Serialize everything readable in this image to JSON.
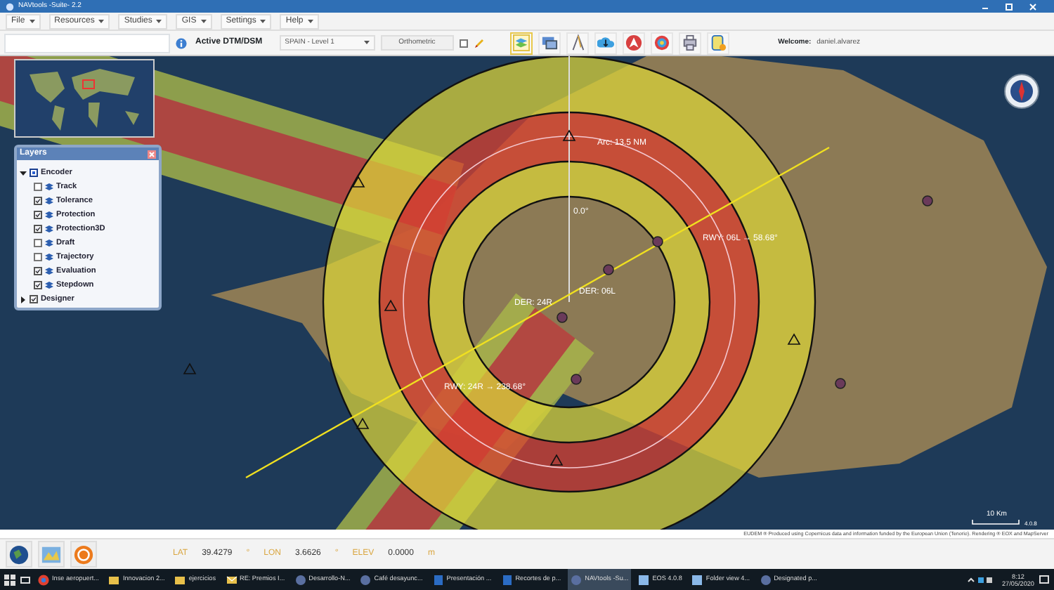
{
  "window": {
    "title": "NAVtools -Suite- 2.2"
  },
  "menu": [
    {
      "label": "File"
    },
    {
      "label": "Resources"
    },
    {
      "label": "Studies"
    },
    {
      "label": "GIS"
    },
    {
      "label": "Settings"
    },
    {
      "label": "Help"
    }
  ],
  "toolbar": {
    "dtm_label": "Active DTM/DSM",
    "dtm_select": "SPAIN - Level 1",
    "height_button": "Orthometric",
    "height_checkbox": {
      "checked": false
    },
    "welcome_label": "Welcome:",
    "welcome_user": "daniel.alvarez"
  },
  "layers": {
    "title": "Layers",
    "items": [
      {
        "label": "Encoder",
        "checked": true,
        "expanded": true,
        "children": [
          {
            "label": "Track",
            "checked": false
          },
          {
            "label": "Tolerance",
            "checked": true
          },
          {
            "label": "Protection",
            "checked": true
          },
          {
            "label": "Protection3D",
            "checked": true
          },
          {
            "label": "Draft",
            "checked": false
          },
          {
            "label": "Trajectory",
            "checked": false
          },
          {
            "label": "Evaluation",
            "checked": true
          },
          {
            "label": "Stepdown",
            "checked": true
          }
        ]
      },
      {
        "label": "Designer",
        "checked": true,
        "expanded": false
      }
    ]
  },
  "map": {
    "labels": [
      {
        "text": "Arc: 13.5 NM"
      },
      {
        "text": "0.0°"
      },
      {
        "text": "RWY: 06L → 58.68°"
      },
      {
        "text": "DER: 06L"
      },
      {
        "text": "DER: 24R"
      },
      {
        "text": "RWY: 24R → 238.68°"
      }
    ],
    "scale": "10 Km",
    "version": "4.0.8",
    "attribution": "EUDEM ® Produced using Copernicus data and information funded by the European Union (Tenorio). Rendering ® EOX and MapServer"
  },
  "status_bar": {
    "lat_label": "LAT",
    "lat": "39.4279",
    "lat_unit": "°",
    "lon_label": "LON",
    "lon": "3.6626",
    "lon_unit": "°",
    "elev_label": "ELEV",
    "elev": "0.0000",
    "elev_unit": "m"
  },
  "taskbar": {
    "items": [
      {
        "label": "Inse aeropuert...",
        "kind": "browser",
        "selected": false
      },
      {
        "label": "Innovacion 2...",
        "kind": "folder",
        "selected": false
      },
      {
        "label": "ejercicios",
        "kind": "folder",
        "selected": false
      },
      {
        "label": "RE: Premios I...",
        "kind": "mail",
        "selected": false
      },
      {
        "label": "Desarrollo-N...",
        "kind": "app",
        "selected": false
      },
      {
        "label": "Café desayunc...",
        "kind": "app",
        "selected": false
      },
      {
        "label": "Presentación ...",
        "kind": "doc",
        "selected": false
      },
      {
        "label": "Recortes de p...",
        "kind": "doc",
        "selected": false
      },
      {
        "label": "NAVtools -Su...",
        "kind": "app",
        "selected": true
      },
      {
        "label": "EOS 4.0.8",
        "kind": "window",
        "selected": false
      },
      {
        "label": "Folder view 4...",
        "kind": "window",
        "selected": false
      },
      {
        "label": "Designated p...",
        "kind": "app",
        "selected": false
      }
    ],
    "time": "8:12",
    "date": "27/05/2020"
  }
}
